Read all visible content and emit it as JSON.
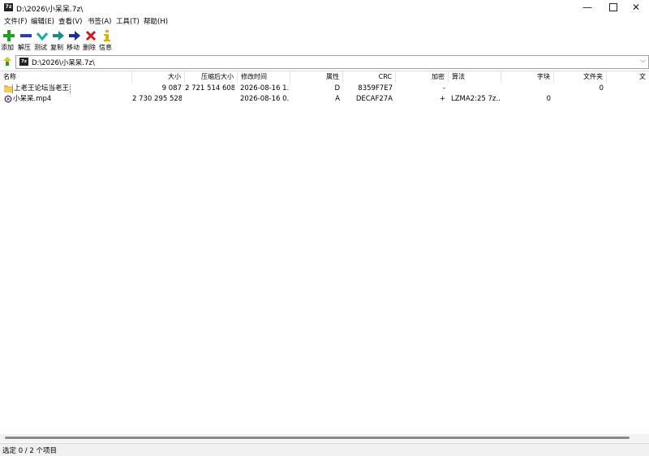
{
  "window": {
    "app_icon": "7z",
    "title": "D:\\2026\\小呆呆.7z\\",
    "minimize_glyph": "—",
    "close_glyph": "✕"
  },
  "menu": [
    {
      "label": "文件(F)"
    },
    {
      "label": "编辑(E)"
    },
    {
      "label": "查看(V)"
    },
    {
      "label": "书签(A)"
    },
    {
      "label": "工具(T)"
    },
    {
      "label": "帮助(H)"
    }
  ],
  "toolbar": [
    {
      "label": "添加",
      "icon": "add-icon",
      "color": "#1ea31e"
    },
    {
      "label": "解压",
      "icon": "extract-icon",
      "color": "#2b3ea8"
    },
    {
      "label": "测试",
      "icon": "test-icon",
      "color": "#1aa7a7"
    },
    {
      "label": "复制",
      "icon": "copy-icon",
      "color": "#1a8c8c"
    },
    {
      "label": "移动",
      "icon": "move-icon",
      "color": "#1f2f8f"
    },
    {
      "label": "删除",
      "icon": "delete-icon",
      "color": "#d01818"
    },
    {
      "label": "信息",
      "icon": "info-icon",
      "color": "#e0b000"
    }
  ],
  "address": {
    "icon": "7z",
    "path": "D:\\2026\\小呆呆.7z\\"
  },
  "columns": [
    {
      "label": "名称"
    },
    {
      "label": "大小"
    },
    {
      "label": "压缩后大小"
    },
    {
      "label": "修改时间"
    },
    {
      "label": "属性"
    },
    {
      "label": "CRC"
    },
    {
      "label": "加密"
    },
    {
      "label": "算法"
    },
    {
      "label": "字块"
    },
    {
      "label": "文件夹"
    },
    {
      "label": "文"
    }
  ],
  "rows": [
    {
      "type": "folder",
      "name": "上老王论坛当老王",
      "size": "9 087",
      "packed": "2 721 514 608",
      "modified": "2026-08-16 1...",
      "attr": "D",
      "crc": "8359F7E7",
      "encrypted": "-",
      "method": "",
      "block": "",
      "folders": "0"
    },
    {
      "type": "video",
      "name": "小呆呆.mp4",
      "size": "2 730 295 528",
      "packed": "",
      "modified": "2026-08-16 0...",
      "attr": "A",
      "crc": "DECAF27A",
      "encrypted": "+",
      "method": "LZMA2:25 7z...",
      "block": "0",
      "folders": ""
    }
  ],
  "status": {
    "text": "选定 0 / 2 个项目"
  }
}
